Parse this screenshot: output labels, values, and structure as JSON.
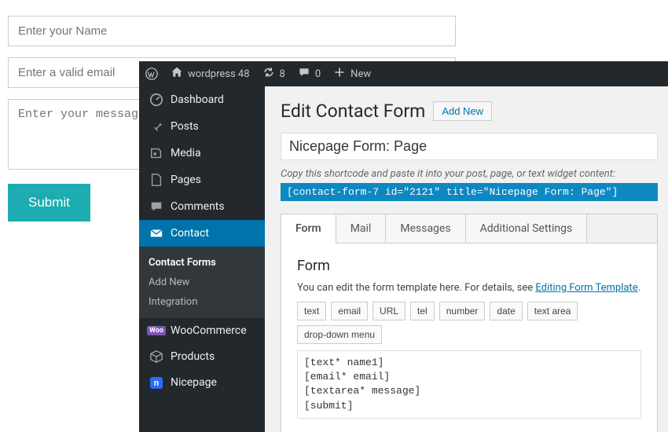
{
  "bgForm": {
    "namePlaceholder": "Enter your Name",
    "emailPlaceholder": "Enter a valid email",
    "messagePlaceholder": "Enter your message",
    "submitLabel": "Submit"
  },
  "adminbar": {
    "siteName": "wordpress 48",
    "updates": "8",
    "comments": "0",
    "newLabel": "New"
  },
  "sidebar": {
    "items": [
      {
        "label": "Dashboard"
      },
      {
        "label": "Posts"
      },
      {
        "label": "Media"
      },
      {
        "label": "Pages"
      },
      {
        "label": "Comments"
      },
      {
        "label": "Contact"
      },
      {
        "label": "WooCommerce"
      },
      {
        "label": "Products"
      },
      {
        "label": "Nicepage"
      }
    ],
    "submenu": {
      "items": [
        {
          "label": "Contact Forms"
        },
        {
          "label": "Add New"
        },
        {
          "label": "Integration"
        }
      ]
    }
  },
  "page": {
    "heading": "Edit Contact Form",
    "addNew": "Add New",
    "formTitle": "Nicepage Form: Page",
    "shortcodeHint": "Copy this shortcode and paste it into your post, page, or text widget content:",
    "shortcode": "[contact-form-7 id=\"2121\" title=\"Nicepage Form: Page\"]"
  },
  "tabs": {
    "labels": [
      "Form",
      "Mail",
      "Messages",
      "Additional Settings"
    ]
  },
  "formPanel": {
    "heading": "Form",
    "descPrefix": "You can edit the form template here. For details, see ",
    "descLink": "Editing Form Template",
    "descSuffix": ".",
    "tagButtons": [
      "text",
      "email",
      "URL",
      "tel",
      "number",
      "date",
      "text area",
      "drop-down menu"
    ],
    "template": "[text* name1]\n[email* email]\n[textarea* message]\n[submit]"
  }
}
